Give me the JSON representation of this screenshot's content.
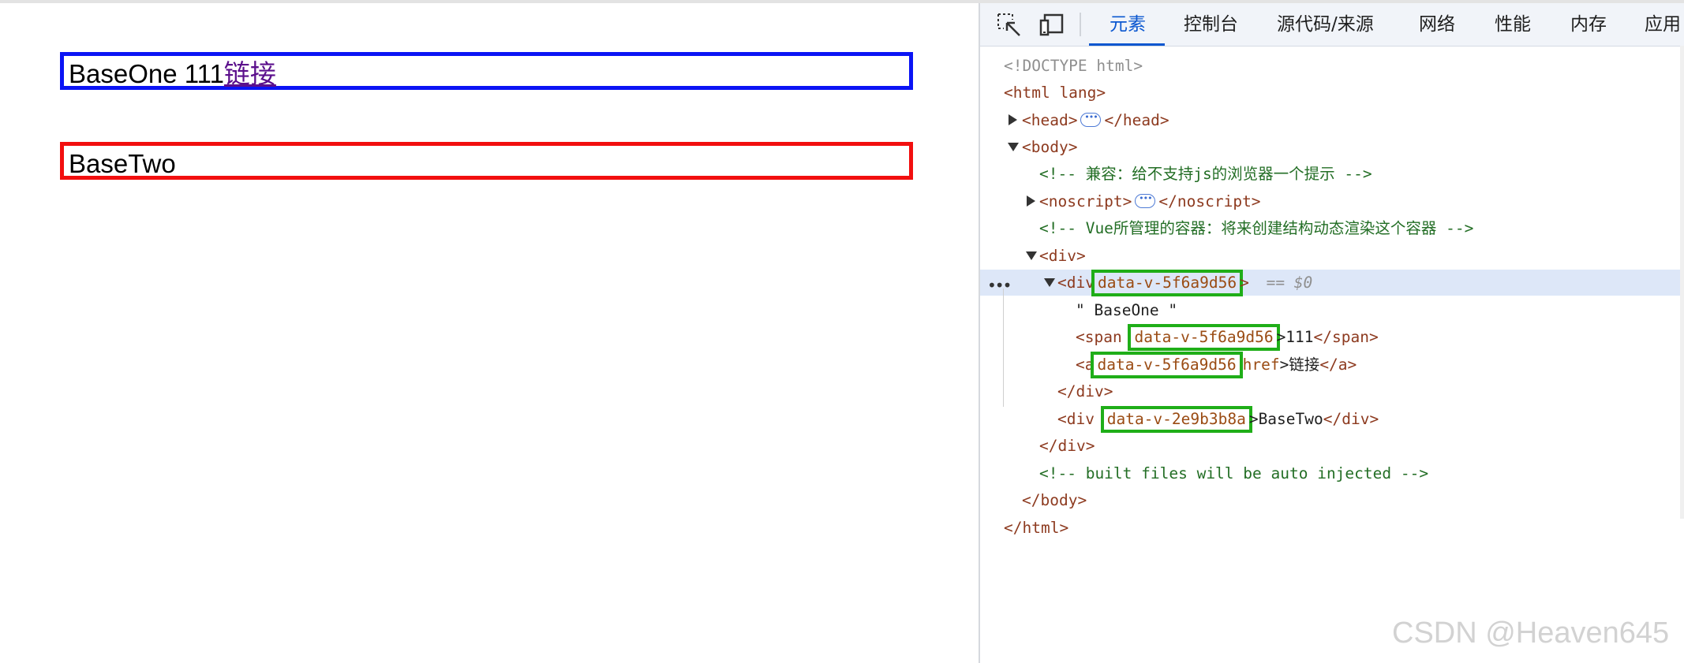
{
  "page": {
    "box_one": {
      "text": "BaseOne 111",
      "link": "链接"
    },
    "box_two": {
      "text": "BaseTwo"
    }
  },
  "devtools": {
    "toolbar": {
      "icons": [
        "inspect-element-icon",
        "device-toolbar-icon"
      ],
      "tabs": [
        "元素",
        "控制台",
        "源代码/来源",
        "网络",
        "性能",
        "内存",
        "应用"
      ],
      "active_tab": "元素"
    },
    "tree": {
      "doctype": "<!DOCTYPE html>",
      "html_open": "<html lang>",
      "head_open": "<head>",
      "head_close": "</head>",
      "body_open": "<body>",
      "comment_compat": "<!-- 兼容：给不支持js的浏览器一个提示 -->",
      "noscript_open": "<noscript>",
      "noscript_close": "</noscript>",
      "comment_vue": "<!-- Vue所管理的容器：将来创建结构动态渲染这个容器 -->",
      "div_open": "<div>",
      "sel_tag": "<div",
      "sel_attr": "data-v-5f6a9d56",
      "sel_end": ">",
      "sel_ref": "== $0",
      "text_node": "\" BaseOne \"",
      "span_tag": "<span",
      "span_attr": "data-v-5f6a9d56",
      "span_text": ">111",
      "span_close": "</span>",
      "a_tag": "<a",
      "a_attr": "data-v-5f6a9d56",
      "a_href": "href",
      "a_text": ">链接",
      "a_close": "</a>",
      "div_close": "</div>",
      "div2_tag": "<div",
      "div2_attr": "data-v-2e9b3b8a",
      "div2_text": ">BaseTwo",
      "div2_close": "</div>",
      "div_close_outer": "</div>",
      "comment_built": "<!-- built files will be auto injected -->",
      "body_close": "</body>",
      "html_close": "</html>"
    }
  },
  "watermark": "CSDN @Heaven645",
  "colors": {
    "box_one_border": "#0b14f5",
    "box_two_border": "#f20f0f",
    "highlight_outline": "#1fae18",
    "active_tab": "#0b57d0",
    "selected_row": "#dde7f8"
  }
}
